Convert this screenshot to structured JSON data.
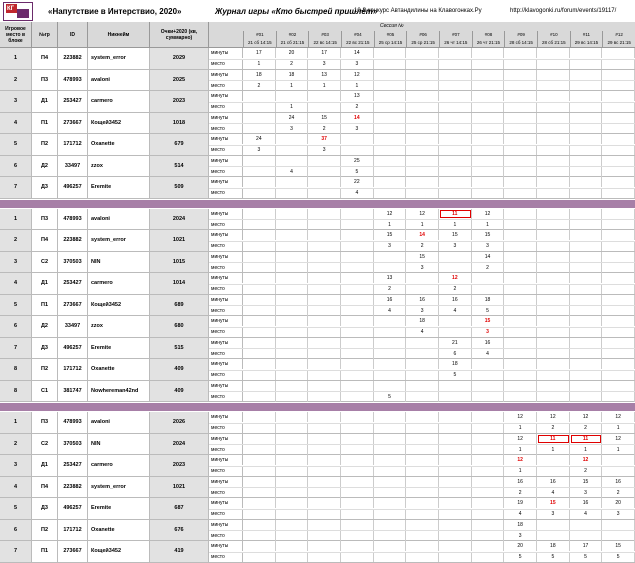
{
  "header": {
    "logo_text": "КГ",
    "title": "«Напутствие в Интерствио, 2020»",
    "journal": "Журнал игры «Кто быстрей пришлёт»",
    "contest": "10-й конкурс Автандилины на Клавогонках.Ру",
    "url": "http://klavogonki.ru/forum/events/19117/"
  },
  "columns": {
    "place": "Игровое место в блоке",
    "ngr": "№гр",
    "id": "ID",
    "nick": "Никнейм",
    "score": "Очки+2020 (кв, суммарно)",
    "session": "Сессия №"
  },
  "session_cols": [
    {
      "num": "#01",
      "date": "21 сб 14:15"
    },
    {
      "num": "#02",
      "date": "21 сб 21:15"
    },
    {
      "num": "#03",
      "date": "22 вс 14:15"
    },
    {
      "num": "#04",
      "date": "22 вс 21:15"
    },
    {
      "num": "#05",
      "date": "25 ср 14:15"
    },
    {
      "num": "#06",
      "date": "25 ср 21:15"
    },
    {
      "num": "#07",
      "date": "26 чт 14:15"
    },
    {
      "num": "#08",
      "date": "26 чт 21:15"
    },
    {
      "num": "#09",
      "date": "28 сб 14:15"
    },
    {
      "num": "#10",
      "date": "28 сб 21:15"
    },
    {
      "num": "#11",
      "date": "29 вс 14:15"
    },
    {
      "num": "#12",
      "date": "29 вс 21:15"
    }
  ],
  "labels": {
    "minutes": "минуты",
    "place": "место"
  },
  "blocks": [
    {
      "rows": [
        {
          "place": "1",
          "grp": "П4",
          "id": "223882",
          "nick": "system_error",
          "score": "2029",
          "m": [
            "17",
            "20",
            "17",
            "14",
            "",
            "",
            "",
            "",
            "",
            "",
            "",
            ""
          ],
          "p": [
            "1",
            "2",
            "3",
            "3",
            "",
            "",
            "",
            "",
            "",
            "",
            "",
            ""
          ],
          "red": []
        },
        {
          "place": "2",
          "grp": "П3",
          "id": "478993",
          "nick": "avaloni",
          "score": "2025",
          "m": [
            "18",
            "18",
            "13",
            "12",
            "",
            "",
            "",
            "",
            "",
            "",
            "",
            ""
          ],
          "p": [
            "2",
            "1",
            "1",
            "1",
            "",
            "",
            "",
            "",
            "",
            "",
            "",
            ""
          ],
          "red": []
        },
        {
          "place": "3",
          "grp": "Д1",
          "id": "253427",
          "nick": "carmero",
          "score": "2023",
          "m": [
            "",
            "",
            "",
            "13",
            "",
            "",
            "",
            "",
            "",
            "",
            "",
            ""
          ],
          "p": [
            "",
            "1",
            "",
            "2",
            "",
            "",
            "",
            "",
            "",
            "",
            "",
            ""
          ],
          "red": []
        },
        {
          "place": "4",
          "grp": "П1",
          "id": "273667",
          "nick": "Кощей3452",
          "score": "1018",
          "m": [
            "",
            "24",
            "15",
            "14",
            "",
            "",
            "",
            "",
            "",
            "",
            "",
            ""
          ],
          "p": [
            "",
            "3",
            "2",
            "3",
            "",
            "",
            "",
            "",
            "",
            "",
            "",
            ""
          ],
          "red": [
            "m3"
          ]
        },
        {
          "place": "5",
          "grp": "П2",
          "id": "171712",
          "nick": "Oxanette",
          "score": "679",
          "m": [
            "24",
            "",
            "37",
            "",
            "",
            "",
            "",
            "",
            "",
            "",
            "",
            ""
          ],
          "p": [
            "3",
            "",
            "3",
            "",
            "",
            "",
            "",
            "",
            "",
            "",
            "",
            ""
          ],
          "red": [
            "m2"
          ]
        },
        {
          "place": "6",
          "grp": "Д2",
          "id": "33497",
          "nick": "zzox",
          "score": "514",
          "m": [
            "",
            "",
            "",
            "25",
            "",
            "",
            "",
            "",
            "",
            "",
            "",
            ""
          ],
          "p": [
            "",
            "4",
            "",
            "5",
            "",
            "",
            "",
            "",
            "",
            "",
            "",
            ""
          ],
          "red": []
        },
        {
          "place": "7",
          "grp": "Д3",
          "id": "496257",
          "nick": "Eremite",
          "score": "509",
          "m": [
            "",
            "",
            "",
            "22",
            "",
            "",
            "",
            "",
            "",
            "",
            "",
            ""
          ],
          "p": [
            "",
            "",
            "",
            "4",
            "",
            "",
            "",
            "",
            "",
            "",
            "",
            ""
          ],
          "red": []
        }
      ]
    },
    {
      "rows": [
        {
          "place": "1",
          "grp": "П3",
          "id": "478993",
          "nick": "avaloni",
          "score": "2024",
          "m": [
            "",
            "",
            "",
            "",
            "12",
            "12",
            "11",
            "12",
            "",
            "",
            "",
            ""
          ],
          "p": [
            "",
            "",
            "",
            "",
            "1",
            "1",
            "1",
            "1",
            "",
            "",
            "",
            ""
          ],
          "red": [
            "m6"
          ],
          "box": [
            "m6"
          ]
        },
        {
          "place": "2",
          "grp": "П4",
          "id": "223882",
          "nick": "system_error",
          "score": "1021",
          "m": [
            "",
            "",
            "",
            "",
            "15",
            "14",
            "15",
            "15",
            "",
            "",
            "",
            ""
          ],
          "p": [
            "",
            "",
            "",
            "",
            "3",
            "2",
            "3",
            "3",
            "",
            "",
            "",
            ""
          ],
          "red": [
            "m5"
          ]
        },
        {
          "place": "3",
          "grp": "С2",
          "id": "370503",
          "nick": "NIN",
          "score": "1015",
          "m": [
            "",
            "",
            "",
            "",
            "",
            "15",
            "",
            "14",
            "",
            "",
            "",
            ""
          ],
          "p": [
            "",
            "",
            "",
            "",
            "",
            "3",
            "",
            "2",
            "",
            "",
            "",
            ""
          ],
          "red": []
        },
        {
          "place": "4",
          "grp": "Д1",
          "id": "253427",
          "nick": "carmero",
          "score": "1014",
          "m": [
            "",
            "",
            "",
            "",
            "13",
            "",
            "12",
            "",
            "",
            "",
            "",
            ""
          ],
          "p": [
            "",
            "",
            "",
            "",
            "2",
            "",
            "2",
            "",
            "",
            "",
            "",
            ""
          ],
          "red": [
            "m6"
          ]
        },
        {
          "place": "5",
          "grp": "П1",
          "id": "273667",
          "nick": "Кощей3452",
          "score": "689",
          "m": [
            "",
            "",
            "",
            "",
            "16",
            "16",
            "16",
            "18",
            "",
            "",
            "",
            ""
          ],
          "p": [
            "",
            "",
            "",
            "",
            "4",
            "3",
            "4",
            "5",
            "",
            "",
            "",
            ""
          ],
          "red": []
        },
        {
          "place": "6",
          "grp": "Д2",
          "id": "33497",
          "nick": "zzox",
          "score": "680",
          "m": [
            "",
            "",
            "",
            "",
            "",
            "18",
            "",
            "15",
            "",
            "",
            "",
            ""
          ],
          "p": [
            "",
            "",
            "",
            "",
            "",
            "4",
            "",
            "3",
            "",
            "",
            "",
            ""
          ],
          "red": [
            "m7",
            "p7"
          ]
        },
        {
          "place": "7",
          "grp": "Д3",
          "id": "496257",
          "nick": "Eremite",
          "score": "515",
          "m": [
            "",
            "",
            "",
            "",
            "",
            "",
            "21",
            "16",
            "",
            "",
            "",
            ""
          ],
          "p": [
            "",
            "",
            "",
            "",
            "",
            "",
            "6",
            "4",
            "",
            "",
            "",
            ""
          ],
          "red": []
        },
        {
          "place": "8",
          "grp": "П2",
          "id": "171712",
          "nick": "Oxanette",
          "score": "409",
          "m": [
            "",
            "",
            "",
            "",
            "",
            "",
            "18",
            "",
            "",
            "",
            "",
            ""
          ],
          "p": [
            "",
            "",
            "",
            "",
            "",
            "",
            "5",
            "",
            "",
            "",
            "",
            ""
          ],
          "red": []
        },
        {
          "place": "8",
          "grp": "С1",
          "id": "381747",
          "nick": "Nowhereman42nd",
          "score": "409",
          "m": [
            "",
            "",
            "",
            "",
            "",
            "",
            "",
            "",
            "",
            "",
            "",
            ""
          ],
          "p": [
            "",
            "",
            "",
            "",
            "5",
            "",
            "",
            "",
            "",
            "",
            "",
            ""
          ],
          "red": []
        }
      ]
    },
    {
      "rows": [
        {
          "place": "1",
          "grp": "П3",
          "id": "478993",
          "nick": "avaloni",
          "score": "2026",
          "m": [
            "",
            "",
            "",
            "",
            "",
            "",
            "",
            "",
            "12",
            "12",
            "12",
            "12"
          ],
          "p": [
            "",
            "",
            "",
            "",
            "",
            "",
            "",
            "",
            "1",
            "2",
            "2",
            "1"
          ],
          "red": []
        },
        {
          "place": "2",
          "grp": "С2",
          "id": "370503",
          "nick": "NIN",
          "score": "2024",
          "m": [
            "",
            "",
            "",
            "",
            "",
            "",
            "",
            "",
            "12",
            "11",
            "11",
            "12"
          ],
          "p": [
            "",
            "",
            "",
            "",
            "",
            "",
            "",
            "",
            "1",
            "1",
            "1",
            "1"
          ],
          "red": [
            "m9",
            "m10"
          ],
          "box": [
            "m9",
            "m10"
          ]
        },
        {
          "place": "3",
          "grp": "Д1",
          "id": "253427",
          "nick": "carmero",
          "score": "2023",
          "m": [
            "",
            "",
            "",
            "",
            "",
            "",
            "",
            "",
            "12",
            "",
            "12",
            ""
          ],
          "p": [
            "",
            "",
            "",
            "",
            "",
            "",
            "",
            "",
            "1",
            "",
            "2",
            ""
          ],
          "red": [
            "m8",
            "m10"
          ]
        },
        {
          "place": "4",
          "grp": "П4",
          "id": "223882",
          "nick": "system_error",
          "score": "1021",
          "m": [
            "",
            "",
            "",
            "",
            "",
            "",
            "",
            "",
            "16",
            "16",
            "15",
            "16"
          ],
          "p": [
            "",
            "",
            "",
            "",
            "",
            "",
            "",
            "",
            "2",
            "4",
            "3",
            "2"
          ],
          "red": []
        },
        {
          "place": "5",
          "grp": "Д3",
          "id": "496257",
          "nick": "Eremite",
          "score": "687",
          "m": [
            "",
            "",
            "",
            "",
            "",
            "",
            "",
            "",
            "19",
            "15",
            "16",
            "20"
          ],
          "p": [
            "",
            "",
            "",
            "",
            "",
            "",
            "",
            "",
            "4",
            "3",
            "4",
            "3"
          ],
          "red": [
            "m9"
          ]
        },
        {
          "place": "6",
          "grp": "П2",
          "id": "171712",
          "nick": "Oxanette",
          "score": "676",
          "m": [
            "",
            "",
            "",
            "",
            "",
            "",
            "",
            "",
            "18",
            "",
            "",
            ""
          ],
          "p": [
            "",
            "",
            "",
            "",
            "",
            "",
            "",
            "",
            "3",
            "",
            "",
            ""
          ],
          "red": []
        },
        {
          "place": "7",
          "grp": "П1",
          "id": "273667",
          "nick": "Кощей3452",
          "score": "419",
          "m": [
            "",
            "",
            "",
            "",
            "",
            "",
            "",
            "",
            "20",
            "18",
            "17",
            "15"
          ],
          "p": [
            "",
            "",
            "",
            "",
            "",
            "",
            "",
            "",
            "5",
            "5",
            "5",
            "5"
          ],
          "red": []
        }
      ]
    }
  ]
}
